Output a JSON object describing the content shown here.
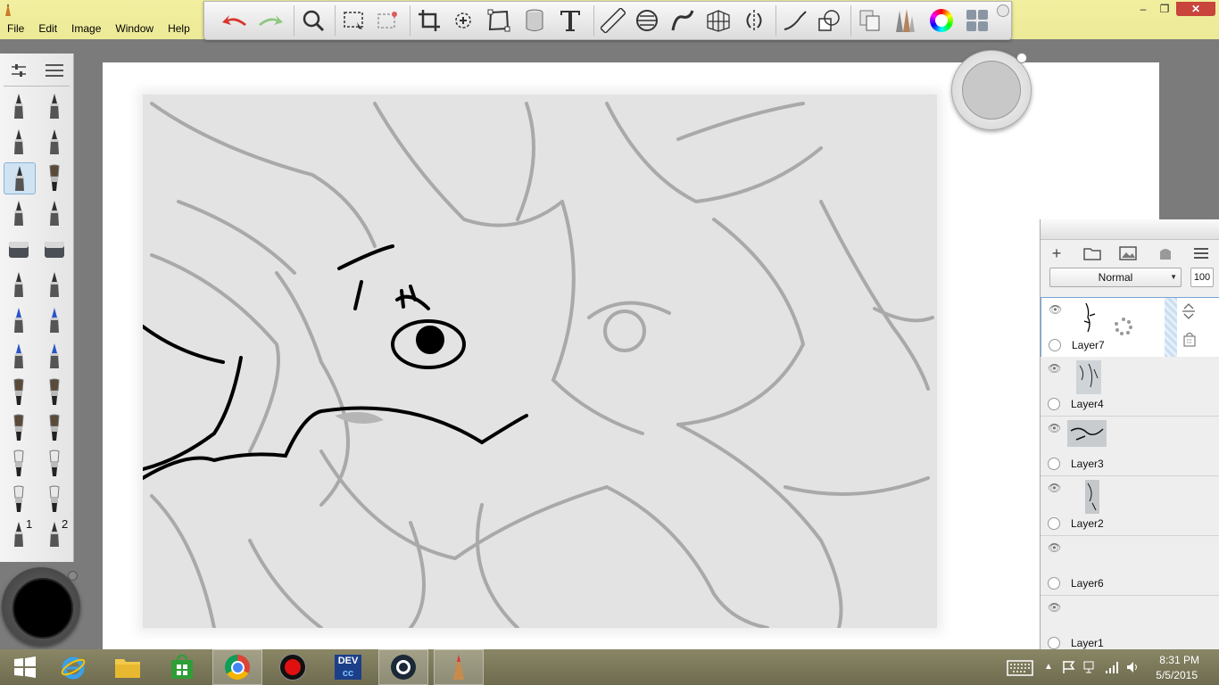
{
  "menu": [
    "File",
    "Edit",
    "Image",
    "Window",
    "Help"
  ],
  "window_controls": {
    "minimize": "–",
    "maximize": "❐",
    "close": "✕"
  },
  "toolbar": {
    "tools": [
      "undo-icon",
      "redo-icon",
      "zoom-icon",
      "rect-select-icon",
      "magic-select-icon",
      "crop-icon",
      "transform-icon",
      "distort-icon",
      "bucket-icon",
      "text-icon",
      "ruler-icon",
      "ellipse-icon",
      "french-curve-icon",
      "perspective-icon",
      "symmetry-icon",
      "stroke-icon",
      "shapes-icon",
      "copy-layers-icon",
      "brush-library-icon",
      "color-wheel-icon",
      "swatches-icon"
    ]
  },
  "brush_palette": {
    "brushes": [
      "pencil",
      "ballpoint",
      "marker",
      "chisel-marker",
      "pen",
      "airbrush",
      "fine-pen",
      "technical-pen",
      "eraser-hard",
      "eraser-soft",
      "felt-tip",
      "felt-tip-2",
      "blue-pencil",
      "blue-marker",
      "blue-pen",
      "ink-pot",
      "round-brush",
      "fan-brush",
      "wet-brush",
      "flat-brush",
      "smudge",
      "blend",
      "smudge-2",
      "blend-2",
      "custom-1",
      "custom-2"
    ],
    "custom_labels": [
      "1",
      "2"
    ]
  },
  "color": {
    "current": "#000000"
  },
  "layers": {
    "blend_mode": "Normal",
    "opacity": "100",
    "items": [
      {
        "name": "Layer7",
        "active": true
      },
      {
        "name": "Layer4",
        "active": false
      },
      {
        "name": "Layer3",
        "active": false
      },
      {
        "name": "Layer2",
        "active": false
      },
      {
        "name": "Layer6",
        "active": false
      },
      {
        "name": "Layer1",
        "active": false
      }
    ]
  },
  "taskbar": {
    "apps": [
      "windows-start",
      "internet-explorer",
      "file-explorer",
      "store",
      "chrome",
      "record",
      "devcc",
      "steam",
      "sketchbook"
    ],
    "time": "8:31 PM",
    "date": "5/5/2015"
  }
}
